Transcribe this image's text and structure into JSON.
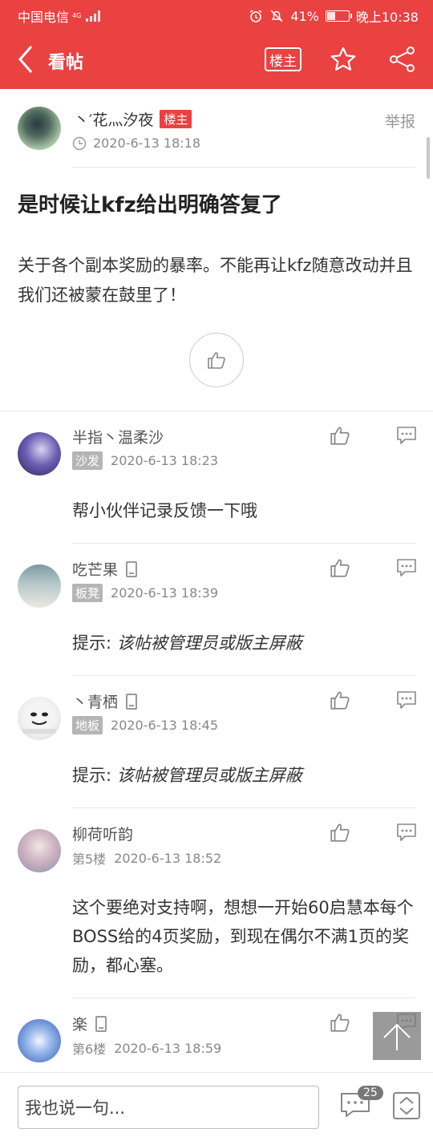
{
  "status_bar": {
    "carrier": "中国电信",
    "network": "4G",
    "battery": "41%",
    "battery_level": 0.41,
    "time": "晚上10:38"
  },
  "header": {
    "back_icon": "back-arrow-icon",
    "title": "看帖",
    "owner_only_label": "楼主",
    "favorite_icon": "star-icon",
    "share_icon": "share-icon",
    "accent_color": "#ea4141"
  },
  "post": {
    "author": "丶′花灬汐夜",
    "author_badge": "楼主",
    "time": "2020-6-13 18:18",
    "report_label": "举报",
    "title": "是时候让kfz给出明确答复了",
    "body": "关于各个副本奖励的暴率。不能再让kfz随意改动并且我们还被蒙在鼓里了！"
  },
  "replies": [
    {
      "name": "半指丶温柔沙",
      "floor": "沙发",
      "time": "2020-6-13 18:23",
      "text": "帮小伙伴记录反馈一下哦",
      "hidden_prefix": "",
      "mobile": false
    },
    {
      "name": "吃芒果",
      "floor": "板凳",
      "time": "2020-6-13 18:39",
      "text": "该帖被管理员或版主屏蔽",
      "hidden_prefix": "提示: ",
      "mobile": true
    },
    {
      "name": "丶青栖",
      "floor": "地板",
      "time": "2020-6-13 18:45",
      "text": "该帖被管理员或版主屏蔽",
      "hidden_prefix": "提示: ",
      "mobile": true
    },
    {
      "name": "柳荷听韵",
      "floor": "第5楼",
      "time": "2020-6-13 18:52",
      "text": "这个要绝对支持啊，想想一开始60启慧本每个BOSS给的4页奖励，到现在偶尔不满1页的奖励，都心塞。",
      "hidden_prefix": "",
      "mobile": false
    },
    {
      "name": "楽",
      "floor": "第6楼",
      "time": "2020-6-13 18:59",
      "text": "",
      "hidden_prefix": "",
      "mobile": true
    }
  ],
  "bottom_bar": {
    "input_placeholder": "我也说一句...",
    "comment_count": "25"
  }
}
